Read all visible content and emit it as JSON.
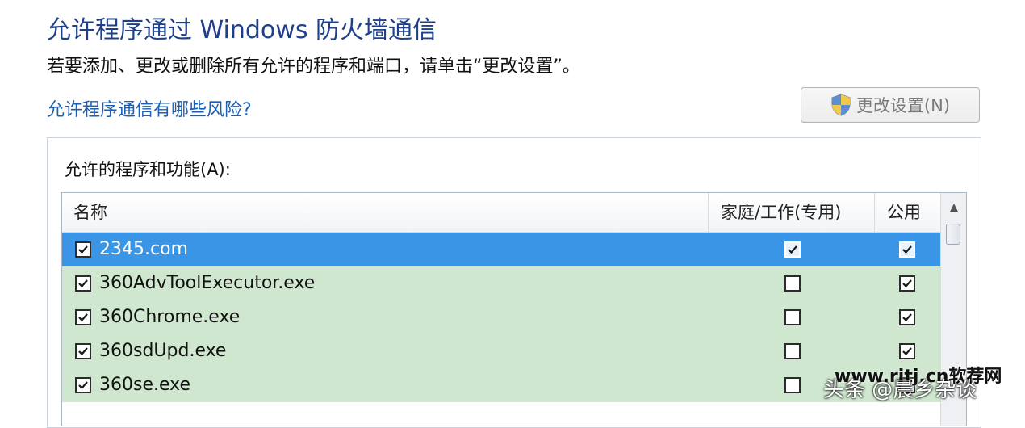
{
  "page": {
    "title": "允许程序通过 Windows 防火墙通信",
    "description": "若要添加、更改或删除所有允许的程序和端口，请单击“更改设置”。",
    "risk_link": "允许程序通信有哪些风险?",
    "change_settings_button": "更改设置(N)"
  },
  "programs": {
    "group_label": "允许的程序和功能(A):",
    "columns": {
      "name": "名称",
      "home_work": "家庭/工作(专用)",
      "public": "公用"
    },
    "rows": [
      {
        "name": "2345.com",
        "enabled": true,
        "home_work": true,
        "public": true,
        "selected": true
      },
      {
        "name": "360AdvToolExecutor.exe",
        "enabled": true,
        "home_work": false,
        "public": true,
        "selected": false
      },
      {
        "name": "360Chrome.exe",
        "enabled": true,
        "home_work": false,
        "public": true,
        "selected": false
      },
      {
        "name": "360sdUpd.exe",
        "enabled": true,
        "home_work": false,
        "public": true,
        "selected": false
      },
      {
        "name": "360se.exe",
        "enabled": true,
        "home_work": false,
        "public": false,
        "selected": false
      }
    ]
  },
  "watermark": {
    "primary": "头条 @晨乡杂谈",
    "secondary": "www.rjtj.cn软荐网"
  },
  "icons": {
    "uac_shield": "shield-icon",
    "scroll_up": "chevron-up-icon",
    "checkbox_check": "check-icon"
  },
  "colors": {
    "title": "#1e3f8a",
    "link": "#1a5fb4",
    "row_allowed": "#cfe7cf",
    "row_selected": "#3b95e6"
  }
}
